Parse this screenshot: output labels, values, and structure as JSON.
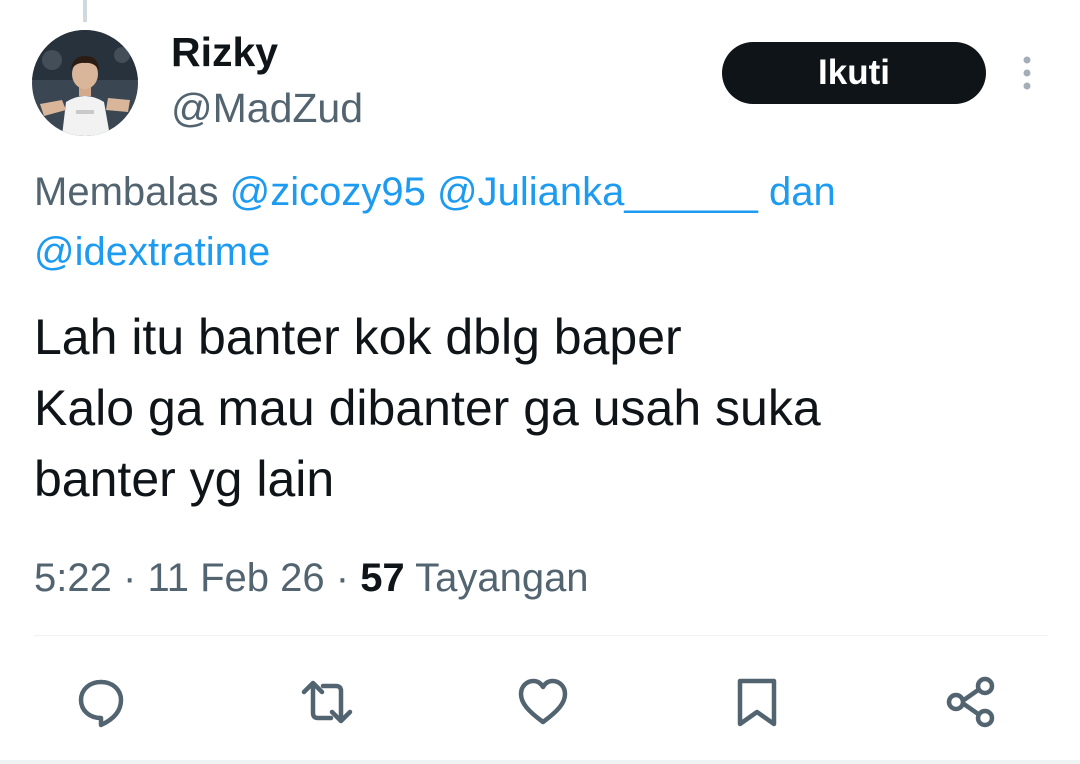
{
  "tweet": {
    "author": {
      "name": "Rizky",
      "handle": "@MadZud",
      "avatar_icon": "profile-photo-icon"
    },
    "follow_label": "Ikuti",
    "reply_to": {
      "prefix": "Membalas",
      "mentions": [
        "@zicozy95",
        "@Julianka______"
      ],
      "conjunction": "dan",
      "last_mention": "@idextratime"
    },
    "text_lines": [
      "Lah itu banter kok dblg baper",
      "Kalo ga mau dibanter ga usah suka",
      "banter yg lain"
    ],
    "meta": {
      "time": "5:22",
      "separator": "·",
      "date": "11 Feb 26",
      "views_count": "57",
      "views_label": "Tayangan"
    },
    "actions": [
      {
        "name": "reply",
        "icon": "comment-icon"
      },
      {
        "name": "repost",
        "icon": "repost-icon"
      },
      {
        "name": "like",
        "icon": "heart-icon"
      },
      {
        "name": "bookmark",
        "icon": "bookmark-icon"
      },
      {
        "name": "share",
        "icon": "share-icon"
      }
    ]
  },
  "colors": {
    "text_primary": "#0f1419",
    "text_secondary": "#536471",
    "link": "#1d9bf0",
    "button_bg": "#0f1419",
    "button_text": "#ffffff",
    "divider": "#eff3f4"
  }
}
